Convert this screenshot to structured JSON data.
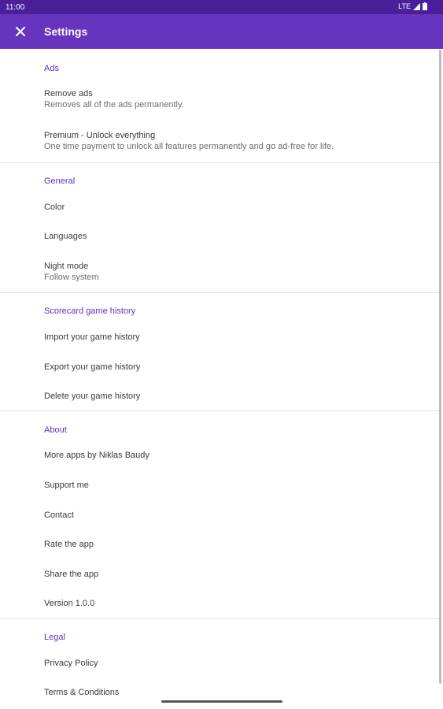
{
  "status_bar": {
    "time": "11:00",
    "network": "LTE"
  },
  "app_bar": {
    "title": "Settings"
  },
  "sections": {
    "ads": {
      "header": "Ads",
      "remove_ads_title": "Remove ads",
      "remove_ads_summary": "Removes all of the ads permanently.",
      "premium_title": "Premium - Unlock everything",
      "premium_summary": "One time payment to unlock all features permanently and go ad-free for life."
    },
    "general": {
      "header": "General",
      "color": "Color",
      "languages": "Languages",
      "night_mode_title": "Night mode",
      "night_mode_summary": "Follow system"
    },
    "history": {
      "header": "Scorecard game history",
      "import": "Import your game history",
      "export": "Export your game history",
      "delete": "Delete your game history"
    },
    "about": {
      "header": "About",
      "more_apps": "More apps by Niklas Baudy",
      "support": "Support me",
      "contact": "Contact",
      "rate": "Rate the app",
      "share": "Share the app",
      "version": "Version 1.0.0"
    },
    "legal": {
      "header": "Legal",
      "privacy": "Privacy Policy",
      "terms": "Terms & Conditions"
    }
  },
  "colors": {
    "primary": "#6734bf",
    "status_bar": "#4a1f99",
    "accent": "#5b32b8"
  }
}
